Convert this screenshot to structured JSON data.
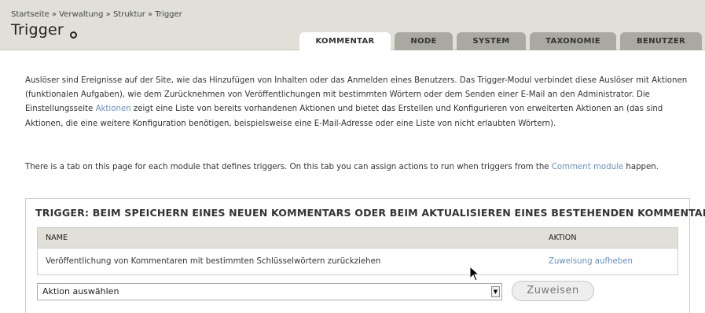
{
  "breadcrumb": "Startseite » Verwaltung » Struktur » Trigger",
  "page_title": "Trigger",
  "tabs": [
    {
      "label": "KOMMENTAR",
      "active": true
    },
    {
      "label": "NODE",
      "active": false
    },
    {
      "label": "SYSTEM",
      "active": false
    },
    {
      "label": "TAXONOMIE",
      "active": false
    },
    {
      "label": "BENUTZER",
      "active": false
    }
  ],
  "intro": {
    "part1": "Auslöser sind Ereignisse auf der Site, wie das Hinzufügen von Inhalten oder das Anmelden eines Benutzers. Das Trigger-Modul verbindet diese Auslöser mit Aktionen (funktionalen Aufgaben), wie dem Zurücknehmen von Veröffentlichungen mit bestimmten Wörtern oder dem Senden einer E-Mail an den Administrator. Die Einstellungsseite ",
    "link": "Aktionen",
    "part2": " zeigt eine Liste von bereits vorhandenen Aktionen und bietet das Erstellen und Konfigurieren von erweiterten Aktionen an (das sind Aktionen, die eine weitere Konfiguration benötigen, beispielsweise eine E-Mail-Adresse oder eine Liste von nicht erlaubten Wörtern)."
  },
  "intro2": {
    "part1": "There is a tab on this page for each module that defines triggers. On this tab you can assign actions to run when triggers from the ",
    "link": "Comment module",
    "part2": " happen."
  },
  "trigger": {
    "legend": "TRIGGER: BEIM SPEICHERN EINES NEUEN KOMMENTARS ODER BEIM AKTUALISIEREN EINES BESTEHENDEN KOMMENTARS",
    "columns": [
      "NAME",
      "AKTION"
    ],
    "rows": [
      {
        "name": "Veröffentlichung von Kommentaren mit bestimmten Schlüsselwörtern zurückziehen",
        "action": "Zuweisung aufheben"
      }
    ],
    "select_value": "Aktion auswählen",
    "button_label": "Zuweisen"
  },
  "colors": {
    "header_bg": "#e0e0d8",
    "tab_inactive": "#a9a9a1",
    "link": "#6b8fb7"
  }
}
